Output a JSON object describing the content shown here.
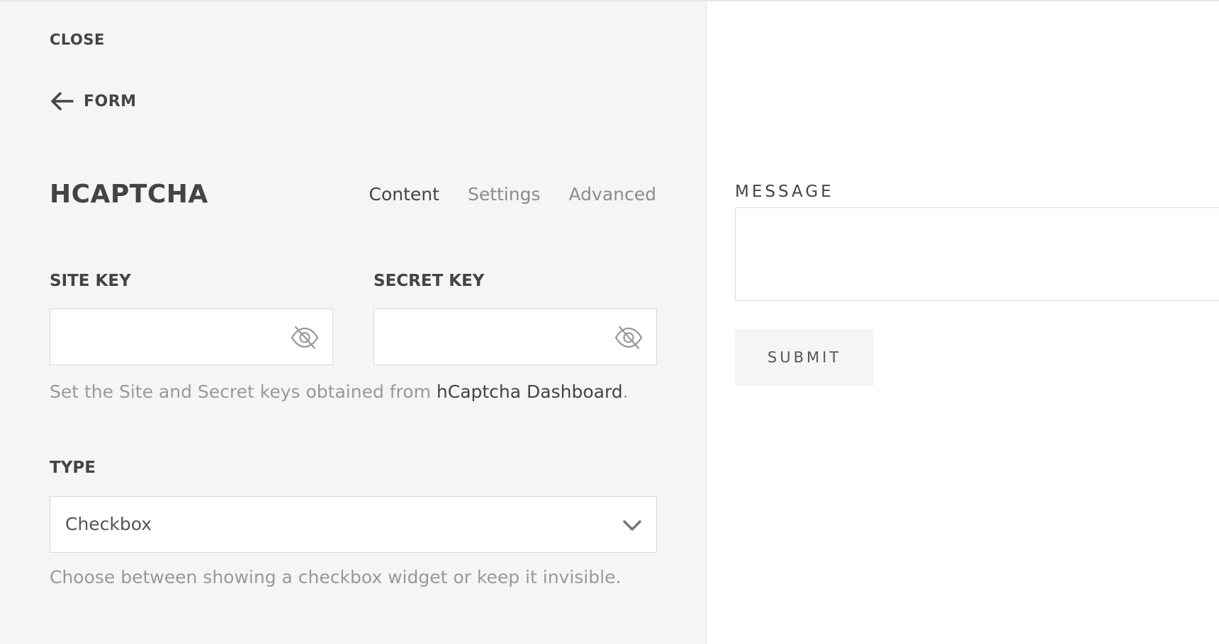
{
  "panel": {
    "close_label": "CLOSE",
    "back_label": "FORM",
    "title": "HCAPTCHA",
    "tabs": [
      {
        "label": "Content",
        "active": true
      },
      {
        "label": "Settings",
        "active": false
      },
      {
        "label": "Advanced",
        "active": false
      }
    ],
    "site_key": {
      "label": "SITE KEY",
      "value": ""
    },
    "secret_key": {
      "label": "SECRET KEY",
      "value": ""
    },
    "keys_help": {
      "prefix": "Set the Site and Secret keys obtained from ",
      "link": "hCaptcha Dashboard",
      "suffix": "."
    },
    "type": {
      "label": "TYPE",
      "selected": "Checkbox",
      "help": "Choose between showing a checkbox widget or keep it invisible."
    }
  },
  "preview": {
    "message_label": "MESSAGE",
    "message_value": "",
    "submit_label": "SUBMIT"
  },
  "colors": {
    "panel_bg": "#f5f5f5",
    "text_dark": "#444444",
    "text_muted": "#999999",
    "border": "#d9d9d9"
  },
  "icons": [
    "arrow-left-icon",
    "eye-slash-icon",
    "chevron-down-icon"
  ]
}
